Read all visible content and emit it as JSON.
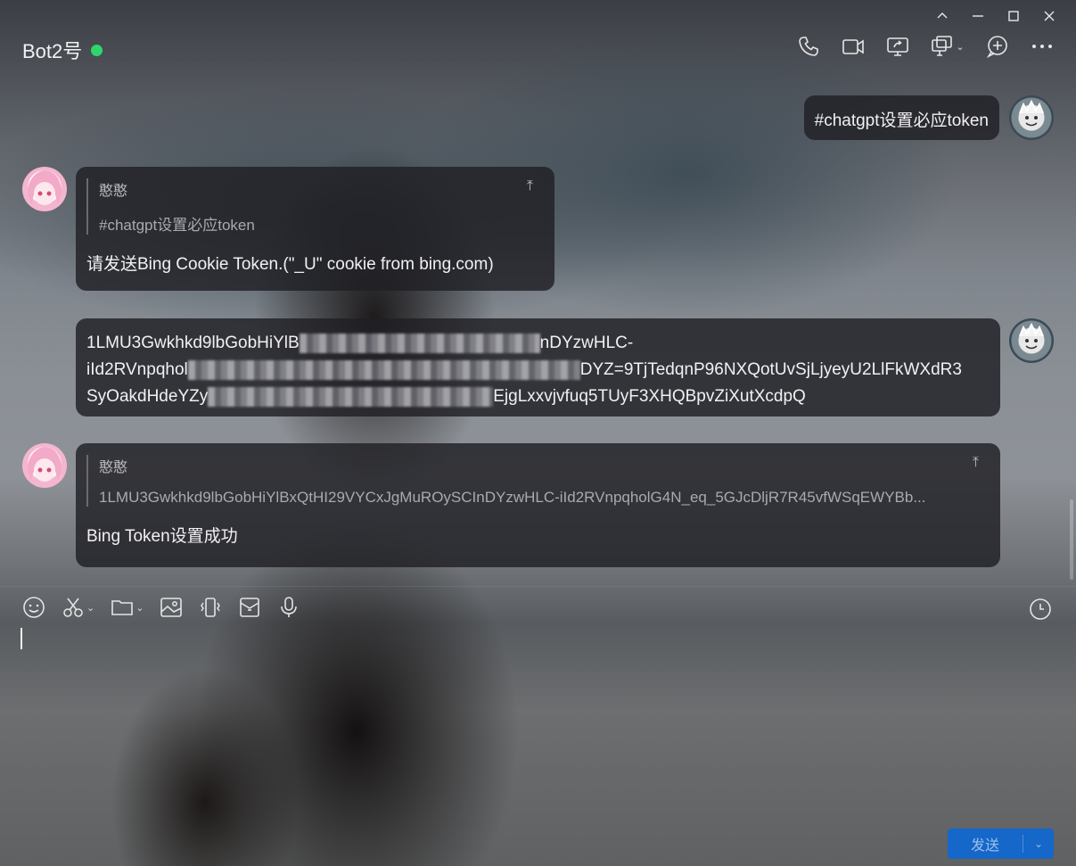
{
  "header": {
    "title": "Bot2号",
    "status": "online",
    "icons": [
      "phone-icon",
      "video-call-icon",
      "screen-share-icon",
      "remote-assist-icon",
      "add-member-icon",
      "more-icon"
    ]
  },
  "window_controls": [
    "collapse-icon",
    "minimize-icon",
    "maximize-icon",
    "close-icon"
  ],
  "messages": [
    {
      "side": "right",
      "text": "#chatgpt设置必应token"
    },
    {
      "side": "left",
      "quote_name": "憨憨",
      "quote_text": "#chatgpt设置必应token",
      "text": "请发送Bing Cookie Token.(\"_U\" cookie from bing.com)"
    },
    {
      "side": "right",
      "line1_start": "1LMU3Gwkhkd9lbGobHiYlB",
      "line1_end": "nDYzwHLC-",
      "line2_start": "iId2RVnpqhol",
      "line2_end": "DYZ=9TjTedqnP96NXQotUvSjLjyeyU2LlFkWXdR3",
      "line3_start": "SyOakdHdeYZy",
      "line3_end": "EjgLxxvjvfuq5TUyF3XHQBpvZiXutXcdpQ"
    },
    {
      "side": "left",
      "quote_name": "憨憨",
      "quote_text": "1LMU3Gwkhkd9lbGobHiYlBxQtHI29VYCxJgMuROySCInDYzwHLC-iId2RVnpqholG4N_eq_5GJcDljR7R45vfWSqEWYBb...",
      "text": "Bing Token设置成功"
    }
  ],
  "toolbar": {
    "icons": [
      "emoji-icon",
      "screenshot-icon",
      "folder-icon",
      "image-icon",
      "shake-icon",
      "red-packet-icon",
      "microphone-icon"
    ],
    "history_icon": "clock-icon"
  },
  "send": {
    "label": "发送"
  },
  "colors": {
    "send_button": "#1567c9",
    "online": "#2fd66a"
  }
}
